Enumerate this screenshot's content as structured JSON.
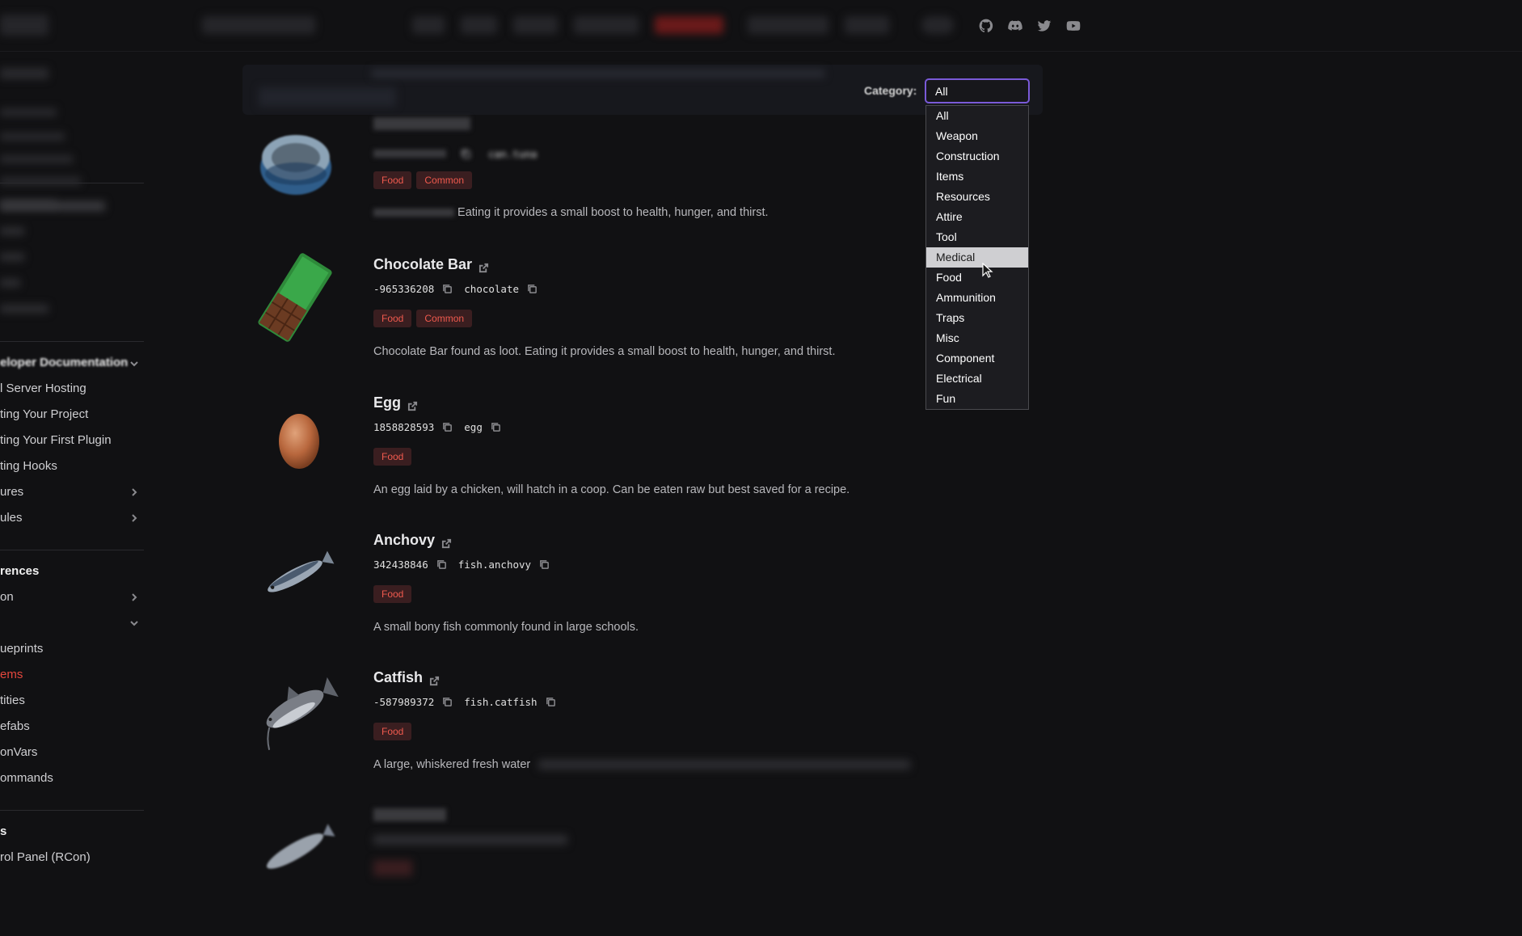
{
  "social_icons": [
    "github-icon",
    "discord-icon",
    "twitter-icon",
    "youtube-icon"
  ],
  "sidebar": {
    "items": [
      {
        "label": "eloper Documentation",
        "heading": true
      },
      {
        "label": "l Server Hosting"
      },
      {
        "label": "ting Your Project"
      },
      {
        "label": "ting Your First Plugin"
      },
      {
        "label": "ting Hooks"
      },
      {
        "label": "ures"
      },
      {
        "label": "ules"
      },
      {
        "label": "rences",
        "heading": true
      },
      {
        "label": "on"
      },
      {
        "label": "ueprints"
      },
      {
        "label": "ems",
        "active": true
      },
      {
        "label": "tities"
      },
      {
        "label": "efabs"
      },
      {
        "label": "onVars"
      },
      {
        "label": "ommands"
      },
      {
        "label": "s",
        "heading": true
      },
      {
        "label": "rol Panel (RCon)"
      }
    ]
  },
  "filter": {
    "category_label": "Category:",
    "selected": "All",
    "options": [
      "All",
      "Weapon",
      "Construction",
      "Items",
      "Resources",
      "Attire",
      "Tool",
      "Medical",
      "Food",
      "Ammunition",
      "Traps",
      "Misc",
      "Component",
      "Electrical",
      "Fun"
    ],
    "hovered": "Medical"
  },
  "items": [
    {
      "title": "Chocolate Bar",
      "id": "-965336208",
      "shortname": "chocolate",
      "tags": [
        "Food",
        "Common"
      ],
      "description": "Chocolate Bar found as loot. Eating it provides a small boost to health, hunger, and thirst."
    },
    {
      "title": "Egg",
      "id": "1858828593",
      "shortname": "egg",
      "tags": [
        "Food"
      ],
      "description": "An egg laid by a chicken, will hatch in a coop. Can be eaten raw but best saved for a recipe."
    },
    {
      "title": "Anchovy",
      "id": "342438846",
      "shortname": "fish.anchovy",
      "tags": [
        "Food"
      ],
      "description": "A small bony fish commonly found in large schools."
    },
    {
      "title": "Catfish",
      "id": "-587989372",
      "shortname": "fish.catfish",
      "tags": [
        "Food"
      ],
      "description": "A large, whiskered fresh water"
    }
  ],
  "partial_item": {
    "id": "can.tuna",
    "tags": [
      "Food",
      "Common"
    ],
    "description": "Eating it provides a small boost to health, hunger, and thirst."
  },
  "colors": {
    "accent": "#e5473d",
    "select_border": "#7a5ad8",
    "tag_bg": "#3a1e20",
    "tag_text": "#f05a4e"
  }
}
